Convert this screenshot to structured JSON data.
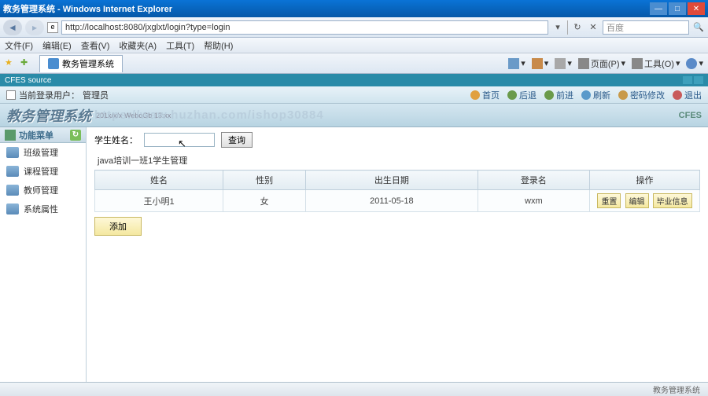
{
  "window": {
    "title": "教务管理系统 - Windows Internet Explorer",
    "url": "http://localhost:8080/jxglxt/login?type=login",
    "search_placeholder": "百度"
  },
  "menu": [
    "文件(F)",
    "编辑(E)",
    "查看(V)",
    "收藏夹(A)",
    "工具(T)",
    "帮助(H)"
  ],
  "tab_title": "教务管理系统",
  "ie_tools": {
    "home": "",
    "page": "页面(P)",
    "tools": "工具(O)"
  },
  "cfes_header": "CFES source",
  "app": {
    "current_user_label": "当前登录用户：",
    "current_user_value": "管理员",
    "toolbar": [
      "首页",
      "后退",
      "前进",
      "刷新",
      "密码修改",
      "退出"
    ],
    "logo": "教务管理系统",
    "sub": "201x/x/x WeboGb 13:xx",
    "cfes": "CFES",
    "watermark": "https://waw.huzhan.com/ishop30884"
  },
  "sidebar": {
    "title": "功能菜单",
    "items": [
      "班级管理",
      "课程管理",
      "教师管理",
      "系统属性"
    ]
  },
  "content": {
    "search_label": "学生姓名：",
    "search_btn": "查询",
    "panel_title": "java培训一班1学生管理",
    "columns": [
      "姓名",
      "性别",
      "出生日期",
      "登录名",
      "操作"
    ],
    "rows": [
      {
        "name": "王小明1",
        "gender": "女",
        "birth": "2011-05-18",
        "login": "wxm"
      }
    ],
    "ops": [
      "重置",
      "编辑",
      "毕业信息"
    ],
    "add_btn": "添加"
  },
  "status": "教务管理系统"
}
